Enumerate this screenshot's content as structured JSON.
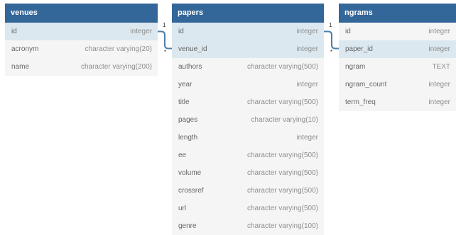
{
  "tables": {
    "venues": {
      "name": "venues",
      "columns": [
        {
          "name": "id",
          "type": "integer"
        },
        {
          "name": "acronym",
          "type": "character varying(20)"
        },
        {
          "name": "name",
          "type": "character varying(200)"
        }
      ]
    },
    "papers": {
      "name": "papers",
      "columns": [
        {
          "name": "id",
          "type": "integer"
        },
        {
          "name": "venue_id",
          "type": "integer"
        },
        {
          "name": "authors",
          "type": "character varying(500)"
        },
        {
          "name": "year",
          "type": "integer"
        },
        {
          "name": "title",
          "type": "character varying(500)"
        },
        {
          "name": "pages",
          "type": "character varying(10)"
        },
        {
          "name": "length",
          "type": "integer"
        },
        {
          "name": "ee",
          "type": "character varying(500)"
        },
        {
          "name": "volume",
          "type": "character varying(500)"
        },
        {
          "name": "crossref",
          "type": "character varying(500)"
        },
        {
          "name": "url",
          "type": "character varying(500)"
        },
        {
          "name": "genre",
          "type": "character varying(100)"
        }
      ]
    },
    "ngrams": {
      "name": "ngrams",
      "columns": [
        {
          "name": "id",
          "type": "integer"
        },
        {
          "name": "paper_id",
          "type": "integer"
        },
        {
          "name": "ngram",
          "type": "TEXT"
        },
        {
          "name": "ngram_count",
          "type": "integer"
        },
        {
          "name": "term_freq",
          "type": "integer"
        }
      ]
    }
  },
  "relationships": [
    {
      "from": "venues.id",
      "to": "papers.venue_id",
      "one": "1",
      "many": "*"
    },
    {
      "from": "papers.id",
      "to": "ngrams.paper_id",
      "one": "1",
      "many": "*"
    }
  ],
  "colors": {
    "header": "#336699",
    "key_row": "#dce8ef",
    "body": "#f5f5f5",
    "connector": "#4a7fa8"
  }
}
